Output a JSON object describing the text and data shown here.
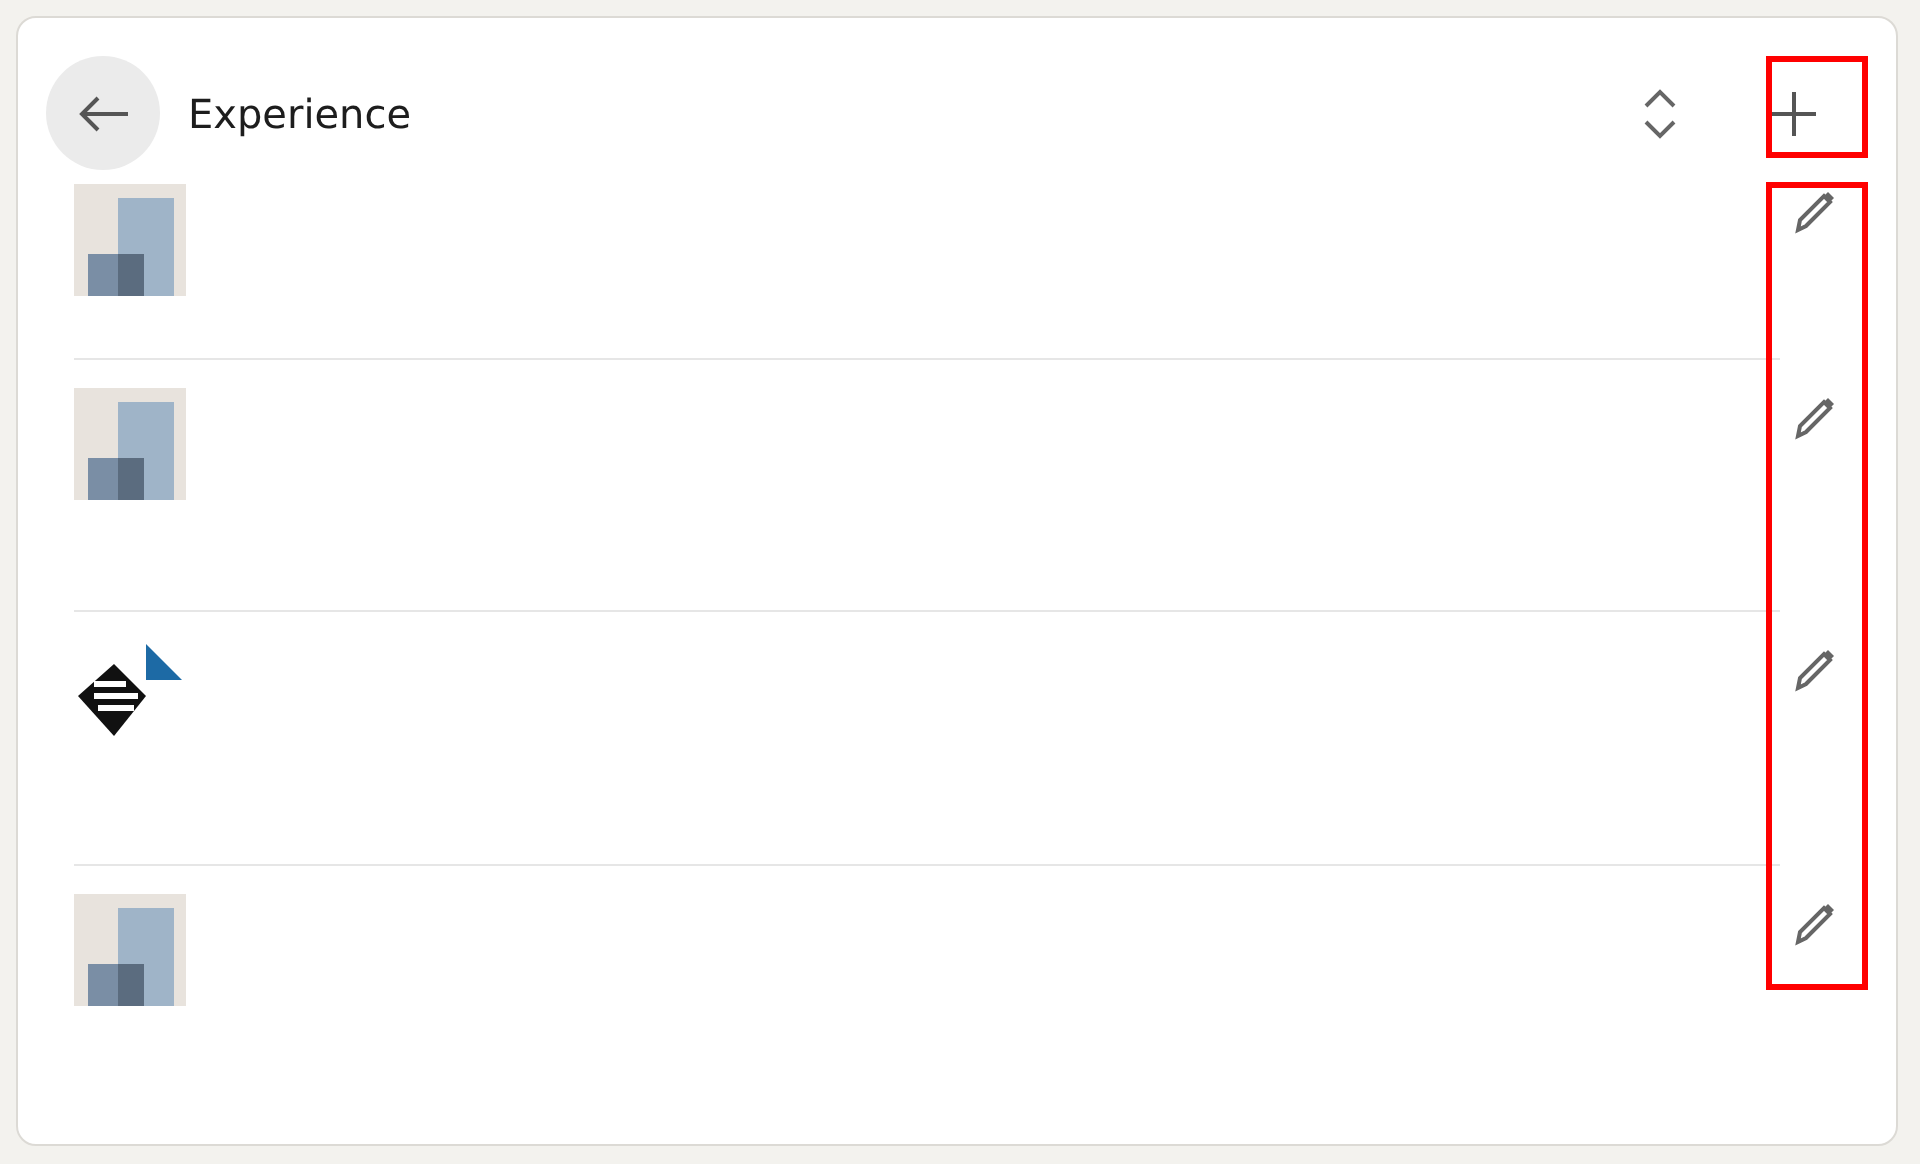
{
  "header": {
    "title": "Experience"
  },
  "entries": [
    {
      "kind": "squares"
    },
    {
      "kind": "squares"
    },
    {
      "kind": "emblem"
    },
    {
      "kind": "squares"
    }
  ],
  "highlights": {
    "add_button": true,
    "edit_buttons": true
  }
}
